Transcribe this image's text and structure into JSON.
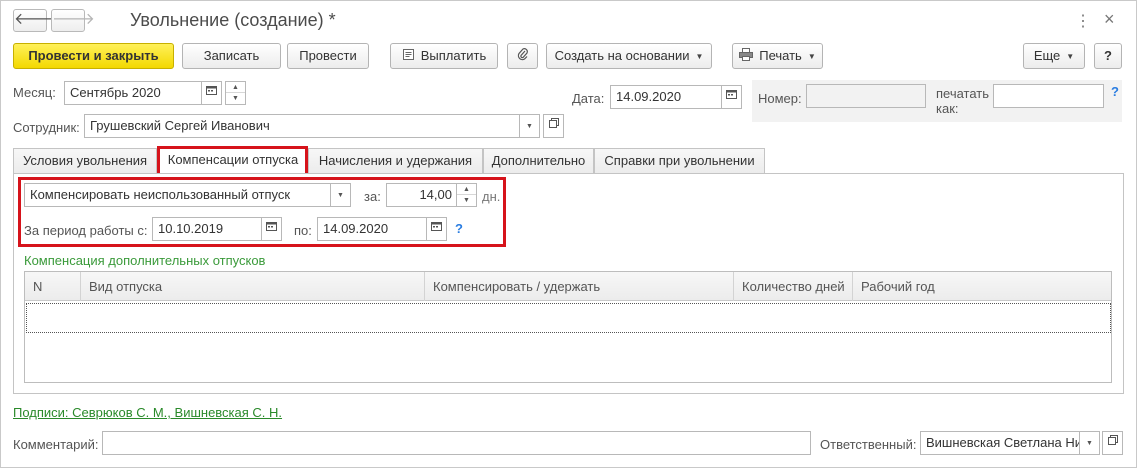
{
  "header": {
    "title": "Увольнение (создание) *",
    "back_icon": "arrow-left",
    "forward_icon": "arrow-right",
    "more_glyph": "⋮",
    "close_glyph": "×"
  },
  "toolbar": {
    "post_close": "Провести и закрыть",
    "save": "Записать",
    "post": "Провести",
    "pay": "Выплатить",
    "create_based": "Создать на основании",
    "print": "Печать",
    "more": "Еще",
    "help": "?"
  },
  "form": {
    "month_label": "Месяц:",
    "month_value": "Сентябрь 2020",
    "date_label": "Дата:",
    "date_value": "14.09.2020",
    "number_label": "Номер:",
    "number_value": "",
    "print_as_label_1": "печатать",
    "print_as_label_2": "как:",
    "print_as_value": "",
    "help": "?",
    "employee_label": "Сотрудник:",
    "employee_value": "Грушевский Сергей Иванович"
  },
  "tabs": [
    {
      "label": "Условия увольнения",
      "active": false
    },
    {
      "label": "Компенсации отпуска",
      "active": true
    },
    {
      "label": "Начисления и удержания",
      "active": false
    },
    {
      "label": "Дополнительно",
      "active": false
    },
    {
      "label": "Справки при увольнении",
      "active": false
    }
  ],
  "compensation": {
    "mode_value": "Компенсировать неиспользованный отпуск",
    "for_label": "за:",
    "days_value": "14,00",
    "days_unit": "дн.",
    "period_label": "За период работы с:",
    "period_from": "10.10.2019",
    "to_label": "по:",
    "period_to": "14.09.2020",
    "help": "?"
  },
  "additional": {
    "section_title": "Компенсация дополнительных отпусков",
    "columns": [
      "N",
      "Вид отпуска",
      "Компенсировать / удержать",
      "Количество дней",
      "Рабочий год"
    ],
    "rows": []
  },
  "footer": {
    "signatures_link": "Подписи: Севрюков С. М., Вишневская С. Н.",
    "comment_label": "Комментарий:",
    "comment_value": "",
    "responsible_label": "Ответственный:",
    "responsible_value": "Вишневская Светлана Ни"
  },
  "colors": {
    "primary_button": "#f3d800",
    "highlight": "#d6131b",
    "section_title": "#3a9a3a",
    "help": "#2a7de1"
  }
}
